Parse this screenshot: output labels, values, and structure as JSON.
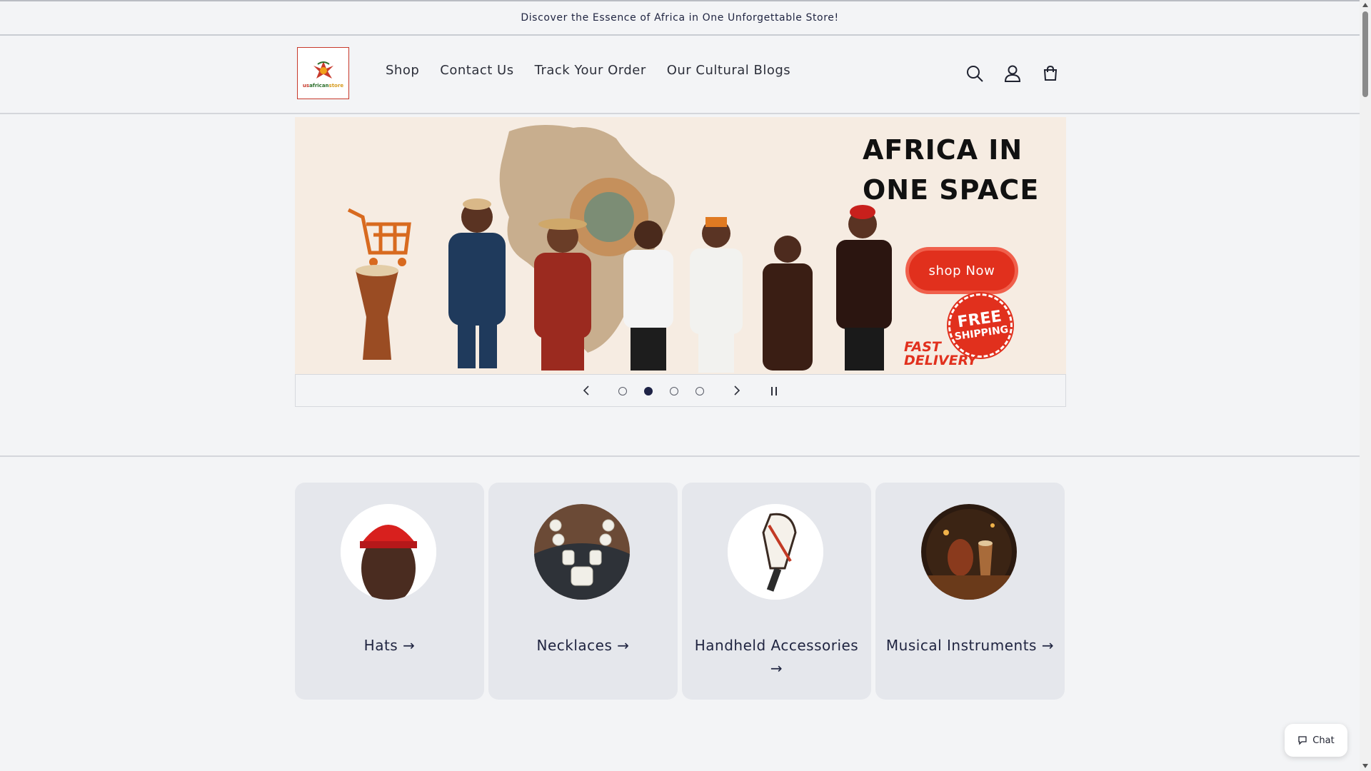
{
  "announcement": {
    "text": "Discover the Essence of Africa in One Unforgettable Store!"
  },
  "header": {
    "logo_text": {
      "part1": "us",
      "part2": "african",
      "part3": "store"
    },
    "nav": [
      {
        "label": "Shop"
      },
      {
        "label": "Contact Us"
      },
      {
        "label": "Track Your Order"
      },
      {
        "label": "Our Cultural Blogs"
      }
    ],
    "icons": [
      "search-icon",
      "account-icon",
      "cart-icon"
    ]
  },
  "banner": {
    "title_line1": "AFRICA IN",
    "title_line2": "ONE SPACE",
    "cta": "shop Now",
    "badge_line1": "FREE",
    "badge_line2": "SHIPPING",
    "fast_line1": "FAST",
    "fast_line2": "DELIVERY",
    "slide_count": 4,
    "active_slide": 2
  },
  "slider": {
    "prev_icon": "chevron-left-icon",
    "next_icon": "chevron-right-icon",
    "pause_icon": "pause-icon"
  },
  "categories": [
    {
      "label": "Hats →"
    },
    {
      "label": "Necklaces →"
    },
    {
      "label": "Handheld Accessories →"
    },
    {
      "label": "Musical Instruments →"
    }
  ],
  "chat": {
    "label": "Chat"
  },
  "colors": {
    "accent_red": "#e1301d",
    "text_dark": "#1f2440",
    "background": "#f3f4f6",
    "card": "#e5e7ec"
  }
}
